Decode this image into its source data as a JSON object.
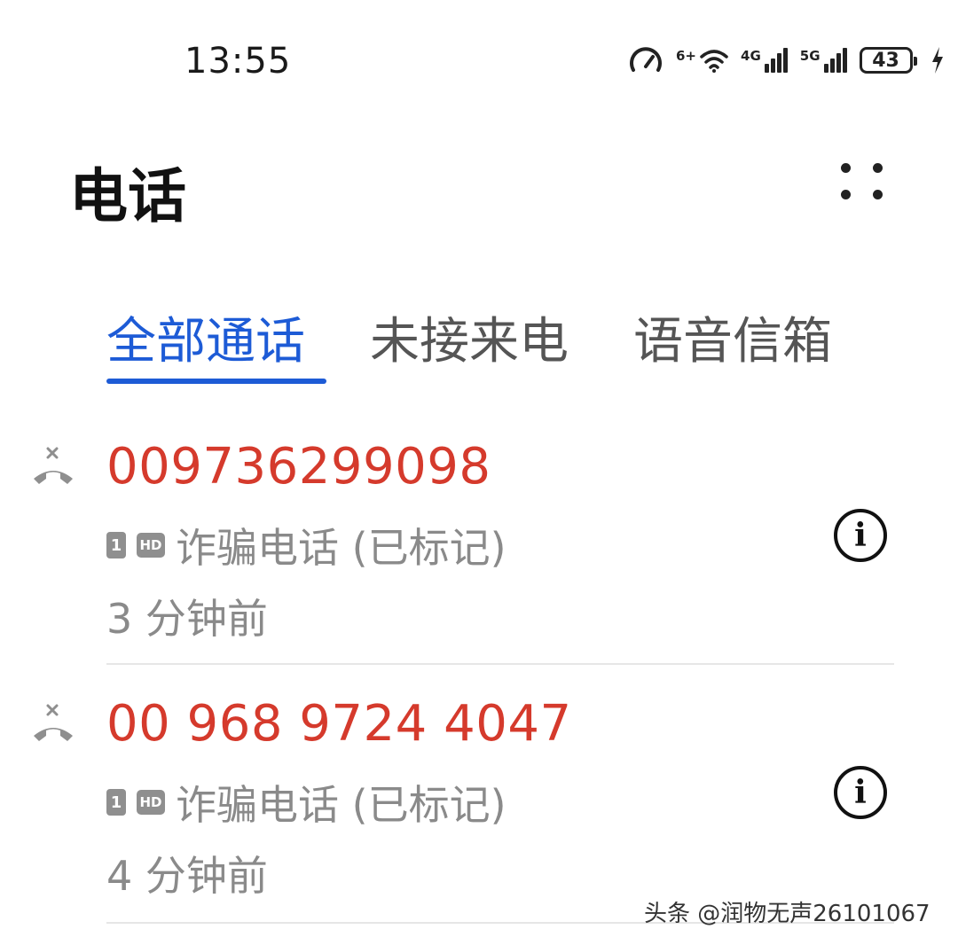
{
  "status_bar": {
    "time": "13:55",
    "wifi_tag": "6+",
    "signal_1_tag": "4G",
    "signal_2_tag": "5G",
    "battery": "43"
  },
  "header": {
    "title": "电话",
    "more_icon": "more-dots-icon"
  },
  "tabs": [
    {
      "label": "全部通话",
      "active": true
    },
    {
      "label": "未接来电",
      "active": false
    },
    {
      "label": "语音信箱",
      "active": false
    }
  ],
  "calls": [
    {
      "number": "009736299098",
      "sim": "1",
      "hd": "HD",
      "tag": "诈骗电话 (已标记)",
      "time": "3 分钟前"
    },
    {
      "number": "00 968 9724 4047",
      "sim": "1",
      "hd": "HD",
      "tag": "诈骗电话 (已标记)",
      "time": "4 分钟前"
    }
  ],
  "colors": {
    "accent": "#1d5bd6",
    "missed": "#d53a2c",
    "secondary": "#8a8a8a"
  },
  "watermark": "头条 @润物无声26101067"
}
